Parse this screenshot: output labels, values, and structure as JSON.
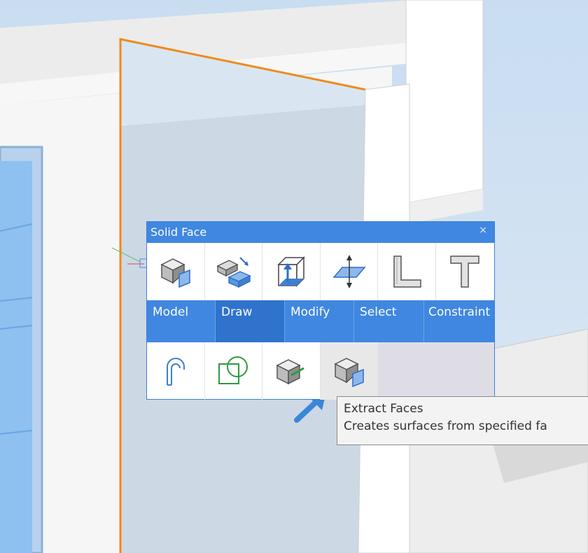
{
  "quad": {
    "title": "Solid Face",
    "close_symbol": "×",
    "top_tools": [
      {
        "name": "solid-box-icon"
      },
      {
        "name": "draw-bricks-icon"
      },
      {
        "name": "modify-extrude-box-icon"
      },
      {
        "name": "select-plane-arrows-icon"
      },
      {
        "name": "l-profile-icon"
      },
      {
        "name": "t-profile-icon"
      }
    ],
    "tabs": [
      "Model",
      "Draw",
      "Modify",
      "Select",
      "Constraint"
    ],
    "active_tab": "Draw",
    "bottom_tools": [
      {
        "name": "arc-profile-icon"
      },
      {
        "name": "square-circle-icon"
      },
      {
        "name": "cube-green-edge-icon"
      },
      {
        "name": "extract-faces-icon"
      }
    ]
  },
  "tooltip": {
    "title": "Extract Faces",
    "description": "Creates surfaces from specified fa"
  },
  "colors": {
    "quad_accent": "#3f87e0",
    "selection_orange": "#f08a1c",
    "pointer_arrow": "#3a86d8"
  }
}
